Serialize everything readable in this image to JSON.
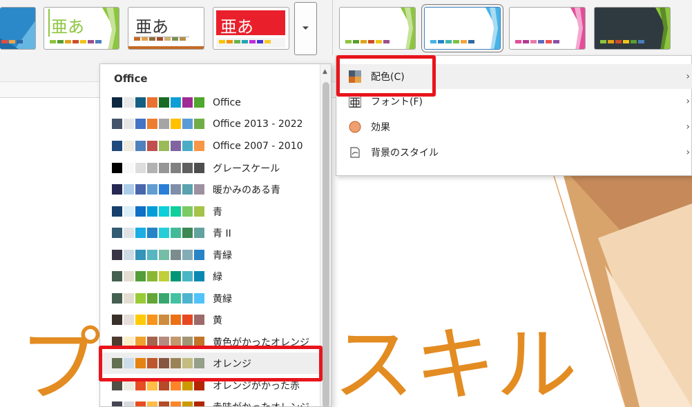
{
  "theme_gallery": {
    "thumbs": [
      {
        "id": "t1",
        "glyph": "",
        "bg": "#2c89c9",
        "palette": [
          "#e54b3c",
          "#f4a340",
          "#2b6aa8"
        ]
      },
      {
        "id": "t2",
        "glyph": "亜あ",
        "glyph_color": "#8cc63e",
        "bg": "#ffffff",
        "accent": "#8cc63e",
        "palette": [
          "#8cc63e",
          "#5a9e2f",
          "#e3a21a",
          "#d04b27",
          "#f0c419",
          "#9b4e8f",
          "#4a7ebb"
        ]
      },
      {
        "id": "t3",
        "glyph": "亜あ",
        "glyph_color": "#333333",
        "bg": "#ffffff",
        "accent": "#c46a25",
        "palette": [
          "#c46a25",
          "#e2a14a",
          "#8f6c3a",
          "#a24b28",
          "#d1b06b",
          "#7a8f51",
          "#b58f4a"
        ]
      },
      {
        "id": "t4",
        "glyph": "亜あ",
        "glyph_color": "#ffffff",
        "bg": "#e9202b",
        "accent": "#e9202b",
        "palette": [
          "#f8c400",
          "#f29100",
          "#6ab04c",
          "#22a6b3",
          "#be2edd",
          "#4834d4",
          "#f9ca24"
        ]
      }
    ],
    "more_icon": "more-gallery-icon"
  },
  "variants": {
    "thumbs": [
      {
        "id": "v1",
        "accent": "#8cc63e",
        "bg": "#ffffff",
        "palette": [
          "#8cc63e",
          "#5a9e2f",
          "#e3a21a",
          "#d04b27",
          "#f0c419",
          "#9b4e8f"
        ]
      },
      {
        "id": "v2",
        "accent": "#48b3e6",
        "bg": "#ffffff",
        "palette": [
          "#48b3e6",
          "#2a84c6",
          "#40b5ad",
          "#7ac143",
          "#f4a340",
          "#2d6aa0"
        ],
        "selected": true
      },
      {
        "id": "v3",
        "accent": "#e44c9a",
        "bg": "#ffffff",
        "palette": [
          "#e44c9a",
          "#b23a8e",
          "#e97aa8",
          "#5c6bc0",
          "#ef5350",
          "#8d4fa5"
        ]
      },
      {
        "id": "v4",
        "accent": "#8cc63e",
        "bg": "#2f3a40",
        "palette": [
          "#8cc63e",
          "#e3a21a",
          "#d04b27",
          "#f0c419",
          "#5a9e2f",
          "#4a7ebb"
        ]
      }
    ]
  },
  "submenu": {
    "items": [
      {
        "label": "配色(C)",
        "icon": "color-scheme-icon",
        "active": true
      },
      {
        "label": "フォント(F)",
        "icon": "font-icon",
        "active": false
      },
      {
        "label": "効果",
        "icon": "effects-icon",
        "active": false
      },
      {
        "label": "背景のスタイル",
        "icon": "background-style-icon",
        "active": false
      }
    ]
  },
  "dropdown": {
    "section_title": "Office",
    "schemes": [
      {
        "label": "Office",
        "colors": [
          "#0e2841",
          "#e8e8e8",
          "#156082",
          "#e97132",
          "#196b24",
          "#0f9ed5",
          "#a02b93",
          "#4ea72e"
        ]
      },
      {
        "label": "Office 2013 - 2022",
        "colors": [
          "#44546a",
          "#e7e6e6",
          "#4472c4",
          "#ed7d31",
          "#a5a5a5",
          "#ffc000",
          "#5b9bd5",
          "#70ad47"
        ]
      },
      {
        "label": "Office 2007 - 2010",
        "colors": [
          "#1f497d",
          "#eeece1",
          "#4f81bd",
          "#c0504d",
          "#9bbb59",
          "#8064a2",
          "#4bacc6",
          "#f79646"
        ]
      },
      {
        "label": "グレースケール",
        "colors": [
          "#000000",
          "#f8f8f8",
          "#dddddd",
          "#b2b2b2",
          "#969696",
          "#808080",
          "#5f5f5f",
          "#4d4d4d"
        ]
      },
      {
        "label": "暖かみのある青",
        "colors": [
          "#242852",
          "#acccea",
          "#4a66ac",
          "#629dd1",
          "#297fd5",
          "#7f8fa9",
          "#5aa2ae",
          "#9d90a0"
        ]
      },
      {
        "label": "青",
        "colors": [
          "#17406d",
          "#dbeff9",
          "#0f6fc6",
          "#009dd9",
          "#0bd0d9",
          "#10cf9b",
          "#7cca62",
          "#a5c249"
        ]
      },
      {
        "label": "青 II",
        "colors": [
          "#335b74",
          "#dfe3e5",
          "#1cade4",
          "#2683c6",
          "#27ced7",
          "#42ba97",
          "#3e8853",
          "#62a39f"
        ]
      },
      {
        "label": "青緑",
        "colors": [
          "#373545",
          "#cedbe6",
          "#3494ba",
          "#58b6c0",
          "#75bda7",
          "#7a8c8e",
          "#84acb6",
          "#2683c6"
        ]
      },
      {
        "label": "緑",
        "colors": [
          "#455f51",
          "#e3ded1",
          "#549e39",
          "#8ab833",
          "#c0cf3a",
          "#029676",
          "#4ab5c4",
          "#0989b1"
        ]
      },
      {
        "label": "黄緑",
        "colors": [
          "#455f51",
          "#e3ded1",
          "#99cb38",
          "#63a537",
          "#37a76f",
          "#44c1a3",
          "#4eb3cf",
          "#51c3f9"
        ]
      },
      {
        "label": "黄",
        "colors": [
          "#39302a",
          "#e5dedb",
          "#ffca08",
          "#f8931d",
          "#ce8d3e",
          "#ec7016",
          "#e64823",
          "#9c6a6a"
        ]
      },
      {
        "label": "黄色がかったオレンジ",
        "colors": [
          "#4e3b30",
          "#fbeec9",
          "#f0a22e",
          "#a5644e",
          "#b58b80",
          "#c3986d",
          "#a19574",
          "#c17529"
        ]
      },
      {
        "label": "オレンジ",
        "colors": [
          "#637052",
          "#ccddea",
          "#e48312",
          "#bd582c",
          "#865640",
          "#9b8357",
          "#c2bc80",
          "#94a088"
        ]
      },
      {
        "label": "オレンジがかった赤",
        "colors": [
          "#505046",
          "#eeece1",
          "#e84c22",
          "#ffbd47",
          "#b64926",
          "#ff8427",
          "#cc9900",
          "#b22600"
        ]
      },
      {
        "label": "赤味がかったオレンジ",
        "colors": [
          "#454551",
          "#d8d9dc",
          "#e84c22",
          "#ffbd47",
          "#b64926",
          "#ff8427",
          "#cc9900",
          "#b22600"
        ]
      }
    ]
  },
  "slide": {
    "title_left": "プ",
    "title_right": "スキル",
    "title_color": "#e38c22"
  }
}
